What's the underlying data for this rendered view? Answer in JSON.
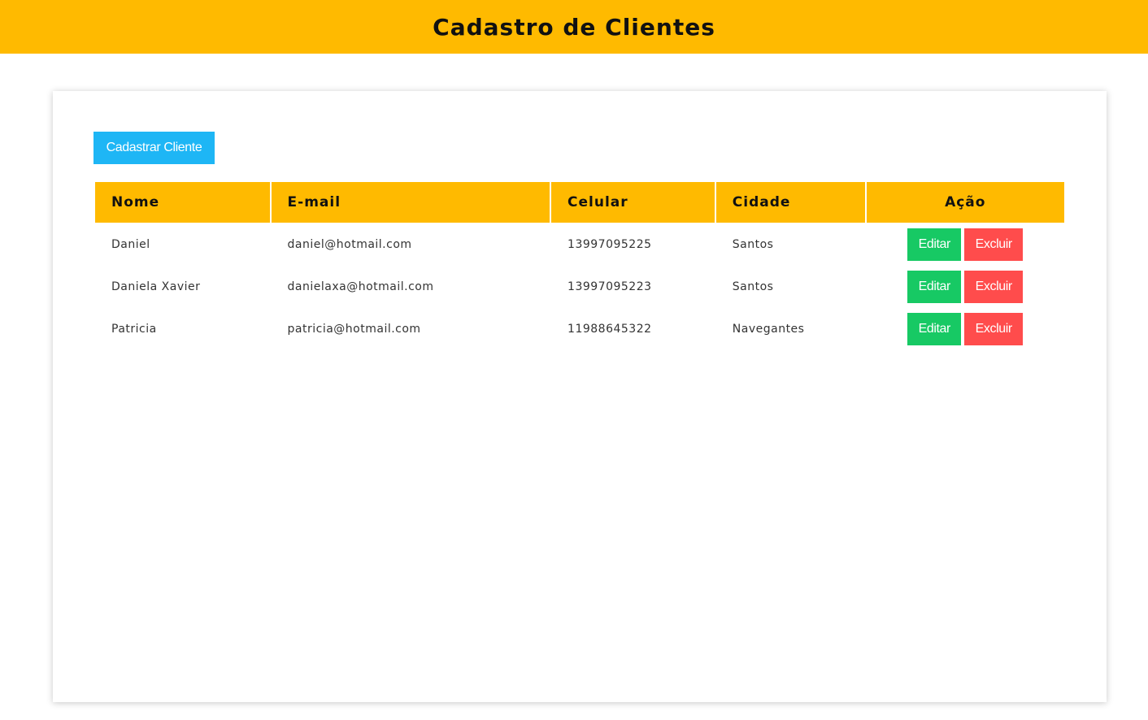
{
  "header": {
    "title": "Cadastro de Clientes"
  },
  "actions": {
    "add_label": "Cadastrar Cliente"
  },
  "table": {
    "columns": [
      "Nome",
      "E-mail",
      "Celular",
      "Cidade",
      "Ação"
    ],
    "rows": [
      {
        "nome": "Daniel",
        "email": "daniel@hotmail.com",
        "celular": "13997095225",
        "cidade": "Santos"
      },
      {
        "nome": "Daniela Xavier",
        "email": "danielaxa@hotmail.com",
        "celular": "13997095223",
        "cidade": "Santos"
      },
      {
        "nome": "Patricia",
        "email": "patricia@hotmail.com",
        "celular": "11988645322",
        "cidade": "Navegantes"
      }
    ],
    "edit_label": "Editar",
    "delete_label": "Excluir"
  },
  "colors": {
    "header": "#ffba00",
    "primary": "#1eb6f5",
    "edit": "#17c964",
    "delete": "#ff4c4c"
  }
}
